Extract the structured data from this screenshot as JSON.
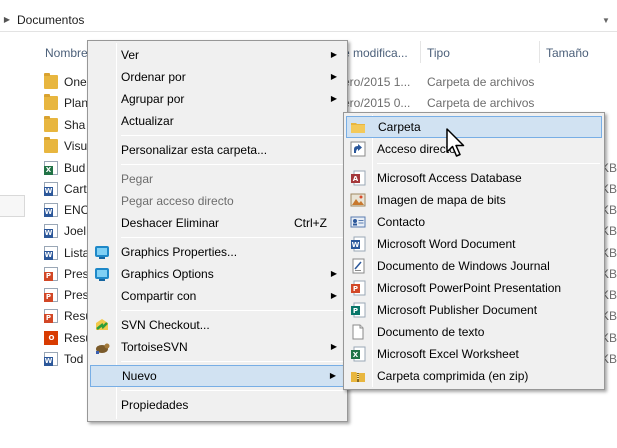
{
  "address": {
    "crumb": "Documentos"
  },
  "columns": {
    "name": "Nombre",
    "modified": "e modifica...",
    "type": "Tipo",
    "size": "Tamaño"
  },
  "files": [
    {
      "name": "One",
      "icon": "folder-icon",
      "modified": "ero/2015 1...",
      "type": "Carpeta de archivos"
    },
    {
      "name": "Plan",
      "icon": "folder-icon",
      "modified": "ero/2015 0...",
      "type": "Carpeta de archivos"
    },
    {
      "name": "Sha",
      "icon": "folder-icon",
      "size": ""
    },
    {
      "name": "Visu",
      "icon": "folder-icon",
      "size": ""
    },
    {
      "name": "Bud",
      "icon": "excel-icon",
      "size": "KB"
    },
    {
      "name": "Cart",
      "icon": "word-icon",
      "size": "KB"
    },
    {
      "name": "ENC",
      "icon": "word-icon",
      "size": "KB"
    },
    {
      "name": "Joel",
      "icon": "word-icon",
      "size": "KB"
    },
    {
      "name": "Lista",
      "icon": "word-icon",
      "size": "KB"
    },
    {
      "name": "Pres",
      "icon": "powerpoint-icon",
      "size": "KB"
    },
    {
      "name": "Pres",
      "icon": "powerpoint-icon",
      "size": "KB"
    },
    {
      "name": "Resu",
      "icon": "powerpoint-icon",
      "size": "KB"
    },
    {
      "name": "Resu",
      "icon": "office-icon",
      "size": "KB"
    },
    {
      "name": "Tod",
      "icon": "word-icon",
      "size": "KB"
    }
  ],
  "context_menu": {
    "items": [
      {
        "label": "Ver",
        "submenu": true
      },
      {
        "label": "Ordenar por",
        "submenu": true
      },
      {
        "label": "Agrupar por",
        "submenu": true
      },
      {
        "label": "Actualizar"
      },
      {
        "label": "Personalizar esta carpeta..."
      },
      {
        "label": "Pegar",
        "disabled": true
      },
      {
        "label": "Pegar acceso directo",
        "disabled": true
      },
      {
        "label": "Deshacer Eliminar",
        "shortcut": "Ctrl+Z"
      },
      {
        "label": "Graphics Properties...",
        "icon": "graphics-icon"
      },
      {
        "label": "Graphics Options",
        "icon": "graphics-icon",
        "submenu": true
      },
      {
        "label": "Compartir con",
        "submenu": true
      },
      {
        "label": "SVN Checkout...",
        "icon": "svn-checkout-icon"
      },
      {
        "label": "TortoiseSVN",
        "icon": "tortoisesvn-icon",
        "submenu": true
      },
      {
        "label": "Nuevo",
        "submenu": true,
        "highlighted": true
      },
      {
        "label": "Propiedades"
      }
    ]
  },
  "new_submenu": {
    "items": [
      {
        "label": "Carpeta",
        "icon": "folder-icon",
        "highlighted": true
      },
      {
        "label": "Acceso directo",
        "icon": "shortcut-icon"
      },
      {
        "label": "Microsoft Access Database",
        "icon": "access-icon"
      },
      {
        "label": "Imagen de mapa de bits",
        "icon": "bitmap-icon"
      },
      {
        "label": "Contacto",
        "icon": "contact-icon"
      },
      {
        "label": "Microsoft Word Document",
        "icon": "word-icon"
      },
      {
        "label": "Documento de Windows Journal",
        "icon": "journal-icon"
      },
      {
        "label": "Microsoft PowerPoint Presentation",
        "icon": "powerpoint-icon"
      },
      {
        "label": "Microsoft Publisher Document",
        "icon": "publisher-icon"
      },
      {
        "label": "Documento de texto",
        "icon": "text-document-icon"
      },
      {
        "label": "Microsoft Excel Worksheet",
        "icon": "excel-icon"
      },
      {
        "label": "Carpeta comprimida (en zip)",
        "icon": "zip-folder-icon"
      }
    ]
  },
  "colors": {
    "header_text": "#4c607a",
    "menu_bg": "#f0f0f0",
    "highlight_bg": "#d1e2f2",
    "highlight_border": "#78aee5",
    "folder": "#e8b63f",
    "word": "#2b579a",
    "excel": "#217346",
    "powerpoint": "#d24726",
    "access": "#a4373a",
    "publisher": "#077568",
    "office": "#d83b01"
  }
}
